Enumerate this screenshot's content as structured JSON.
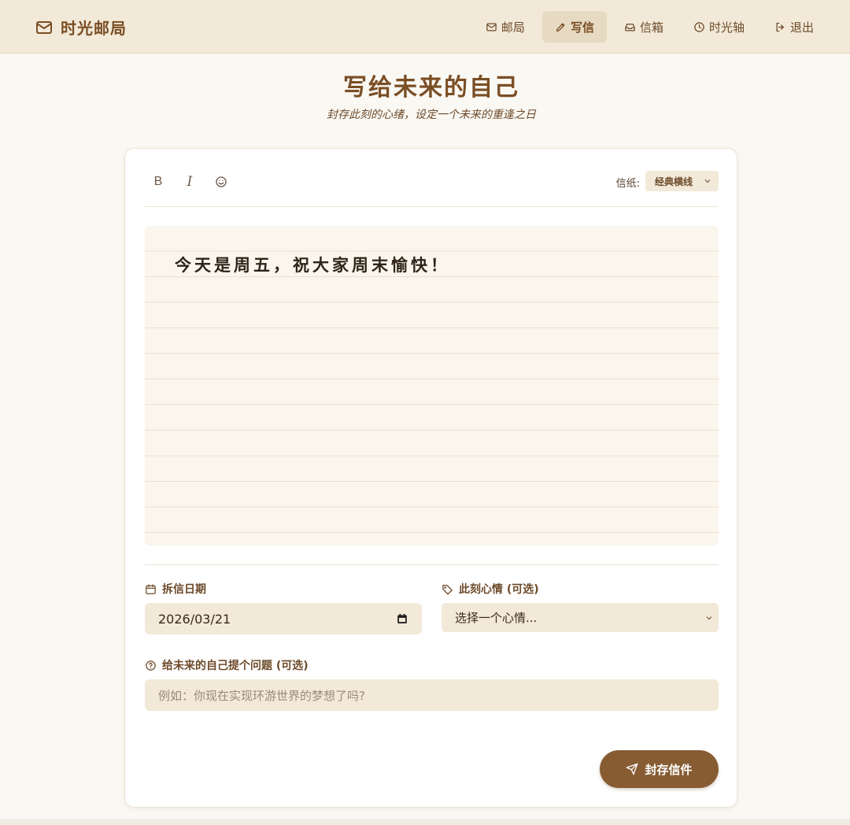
{
  "brand": {
    "name": "时光邮局",
    "icon": "mail-icon"
  },
  "nav": [
    {
      "label": "邮局",
      "icon": "mail-icon",
      "active": false
    },
    {
      "label": "写信",
      "icon": "pen-icon",
      "active": true
    },
    {
      "label": "信箱",
      "icon": "inbox-icon",
      "active": false
    },
    {
      "label": "时光轴",
      "icon": "clock-icon",
      "active": false
    },
    {
      "label": "退出",
      "icon": "logout-icon",
      "active": false
    }
  ],
  "page": {
    "title": "写给未来的自己",
    "subtitle": "封存此刻的心绪，设定一个未来的重逢之日"
  },
  "toolbar": {
    "bold": "B",
    "italic": "I",
    "paper_label": "信纸:",
    "paper_value": "经典横线"
  },
  "letter": {
    "content": "今天是周五，祝大家周末愉快！"
  },
  "fields": {
    "open_date": {
      "label": "拆信日期",
      "value": "2026/03/21"
    },
    "mood": {
      "label": "此刻心情 (可选)",
      "value": "选择一个心情..."
    },
    "question": {
      "label": "给未来的自己提个问题 (可选)",
      "placeholder": "例如：你现在实现环游世界的梦想了吗?"
    }
  },
  "submit": {
    "label": "封存信件"
  },
  "colors": {
    "accent": "#7a4e25",
    "header_bg": "#f2e9d8",
    "button_bg": "#875c33",
    "page_bg": "#faf8f3"
  }
}
